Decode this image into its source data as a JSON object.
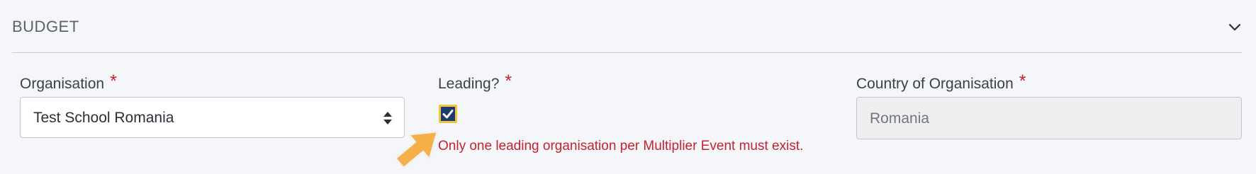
{
  "section": {
    "title": "BUDGET",
    "collapse_icon": "chevron-down-icon"
  },
  "organisation": {
    "label": "Organisation",
    "required_mark": "*",
    "value": "Test School Romania",
    "icon": "sort-arrows-icon"
  },
  "leading": {
    "label": "Leading?",
    "required_mark": "*",
    "checked": true,
    "error": "Only one leading organisation per Multiplier Event must exist."
  },
  "country": {
    "label": "Country of Organisation",
    "required_mark": "*",
    "value": "Romania"
  },
  "colors": {
    "required": "#c4222f",
    "checkbox_fill": "#1a3c73",
    "checkbox_focus": "#f0c537",
    "annotation_arrow": "#f6b04a"
  },
  "annotation": {
    "icon": "pointer-arrow-icon"
  }
}
